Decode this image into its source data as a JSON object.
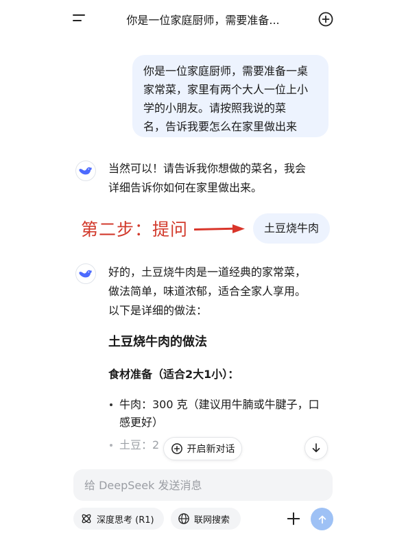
{
  "header": {
    "title": "你是一位家庭厨师，需要准备...",
    "menu_icon": "menu-icon",
    "new_chat_icon": "plus-circle-icon"
  },
  "messages": [
    {
      "role": "user",
      "lines": [
        "你是一位家庭厨师，需要准备一桌",
        "家常菜，家里有两个大人一位上小",
        "学的小朋友。请按照我说的菜",
        "名，告诉我要怎么在家里做出来"
      ]
    },
    {
      "role": "assistant",
      "avatar_icon": "deepseek-whale-icon",
      "lines": [
        "当然可以！请告诉我你想做的菜名，我会",
        "详细告诉你如何在家里做出来。"
      ]
    },
    {
      "role": "user",
      "text": "土豆烧牛肉"
    },
    {
      "role": "assistant",
      "avatar_icon": "deepseek-whale-icon",
      "lines": [
        "好的，土豆烧牛肉是一道经典的家常菜，",
        "做法简单，味道浓郁，适合全家人享用。",
        "以下是详细的做法："
      ],
      "heading": "土豆烧牛肉的做法",
      "subheading": "食材准备（适合2大1小）：",
      "bullets": [
        {
          "lines": [
            "牛肉：300 克（建议用牛腩或牛腱子，口",
            "感更好）"
          ]
        },
        {
          "lines": [
            "土豆：2"
          ]
        }
      ]
    }
  ],
  "annotation": {
    "text": "第二步：提问",
    "color": "#d23a2c"
  },
  "floating": {
    "new_chat_label": "开启新对话",
    "scroll_down_icon": "arrow-down-icon"
  },
  "composer": {
    "placeholder": "给 DeepSeek 发送消息",
    "deep_think_label": "深度思考 (R1)",
    "web_search_label": "联网搜索",
    "send_color": "#9ec1f5"
  }
}
